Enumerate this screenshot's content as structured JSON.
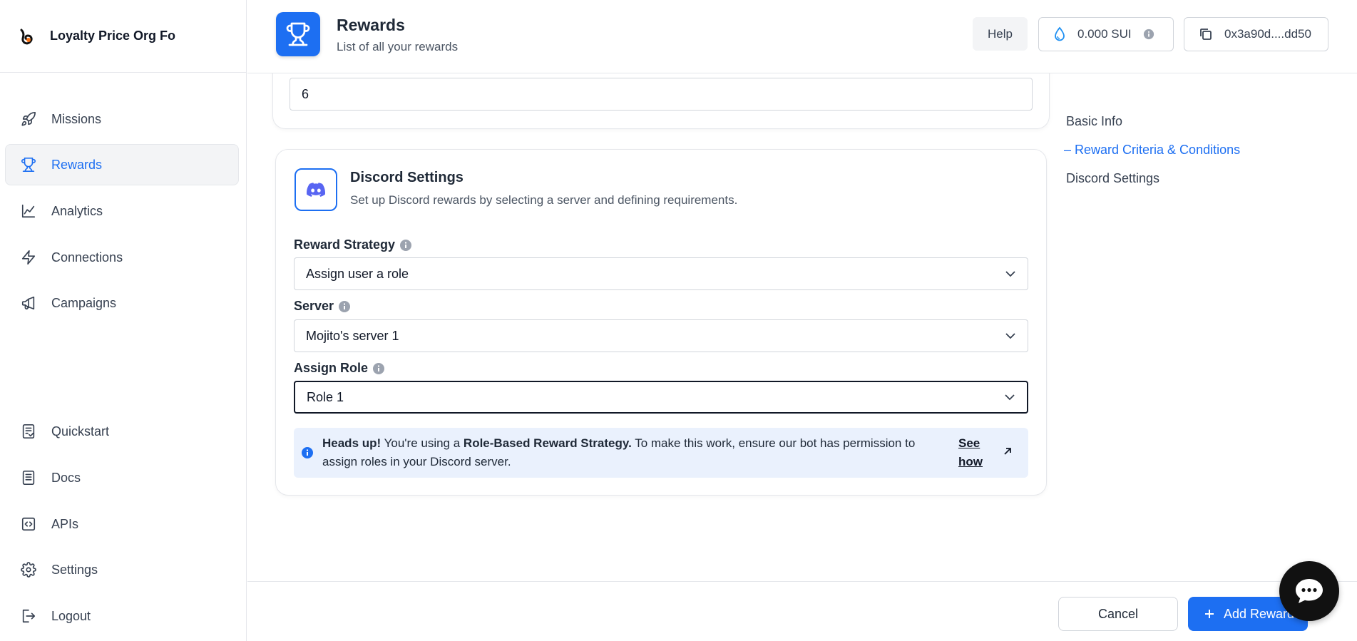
{
  "brand": {
    "name": "Loyalty Price Org Fo"
  },
  "sidebar": {
    "items": [
      {
        "label": "Missions",
        "icon": "rocket-icon"
      },
      {
        "label": "Rewards",
        "icon": "trophy-icon",
        "active": true
      },
      {
        "label": "Analytics",
        "icon": "chart-line-icon"
      },
      {
        "label": "Connections",
        "icon": "lightning-icon"
      },
      {
        "label": "Campaigns",
        "icon": "megaphone-icon"
      }
    ],
    "bottom_items": [
      {
        "label": "Quickstart",
        "icon": "checklist-icon"
      },
      {
        "label": "Docs",
        "icon": "document-icon"
      },
      {
        "label": "APIs",
        "icon": "code-icon"
      },
      {
        "label": "Settings",
        "icon": "gear-icon"
      },
      {
        "label": "Logout",
        "icon": "logout-icon"
      }
    ]
  },
  "header": {
    "title": "Rewards",
    "subtitle": "List of all your rewards",
    "help_label": "Help",
    "balance": "0.000 SUI",
    "address": "0x3a90d....dd50"
  },
  "form": {
    "top_input_value": "6",
    "discord": {
      "title": "Discord Settings",
      "description": "Set up Discord rewards by selecting a server and defining requirements.",
      "reward_strategy_label": "Reward Strategy",
      "reward_strategy_value": "Assign user a role",
      "server_label": "Server",
      "server_value": "Mojito's server 1",
      "assign_role_label": "Assign Role",
      "assign_role_value": "Role 1"
    },
    "alert": {
      "heads_up": "Heads up!",
      "text1": " You're using a ",
      "strategy": "Role-Based Reward Strategy.",
      "text2": " To make this work, ensure our bot has permission to assign roles in your Discord server.",
      "link": "See how"
    }
  },
  "outline": {
    "items": [
      "Basic Info",
      "– Reward Criteria & Conditions",
      "Discord Settings"
    ],
    "active_index": 1
  },
  "footer": {
    "cancel_label": "Cancel",
    "add_label": "Add Reward"
  },
  "colors": {
    "accent": "#1d6ff2",
    "alert_bg": "#eaf1fd",
    "discord": "#5865f2"
  }
}
